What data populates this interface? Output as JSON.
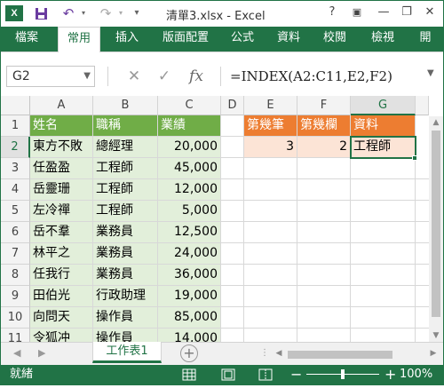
{
  "window": {
    "title": "清單3.xlsx - Excel",
    "help": "?",
    "minimize": "—",
    "restore": "❐",
    "close": "✕"
  },
  "quick_access": {
    "save": "💾",
    "undo": "↶",
    "redo": "↷",
    "customize": "⇩"
  },
  "ribbon": {
    "tabs": [
      "檔案",
      "常用",
      "插入",
      "版面配置",
      "公式",
      "資料",
      "校閱",
      "檢視",
      "開"
    ],
    "active_tab": "常用"
  },
  "formula_bar": {
    "name_box": "G2",
    "cancel_icon": "✕",
    "enter_icon": "✓",
    "fx_icon": "fx",
    "formula": "=INDEX(A2:C11,E2,F2)"
  },
  "columns": [
    "A",
    "B",
    "C",
    "D",
    "E",
    "F",
    "G"
  ],
  "rows": [
    "1",
    "2",
    "3",
    "4",
    "5",
    "6",
    "7",
    "8",
    "9",
    "10",
    "11"
  ],
  "table": {
    "headers": [
      "姓名",
      "職稱",
      "業績"
    ],
    "rows": [
      [
        "東方不敗",
        "總經理",
        "20,000"
      ],
      [
        "任盈盈",
        "工程師",
        "45,000"
      ],
      [
        "岳靈珊",
        "工程師",
        "12,000"
      ],
      [
        "左冷禪",
        "工程師",
        "5,000"
      ],
      [
        "岳不羣",
        "業務員",
        "12,500"
      ],
      [
        "林平之",
        "業務員",
        "24,000"
      ],
      [
        "任我行",
        "業務員",
        "36,000"
      ],
      [
        "田伯光",
        "行政助理",
        "19,000"
      ],
      [
        "向問天",
        "操作員",
        "85,000"
      ],
      [
        "令狐冲",
        "操作員",
        "14,000"
      ]
    ]
  },
  "lookup": {
    "headers": [
      "第幾筆",
      "第幾欄",
      "資料"
    ],
    "values": [
      "3",
      "2",
      "工程師"
    ]
  },
  "sheet_tabs": {
    "prev": "◀",
    "next": "▶",
    "active": "工作表1",
    "add": "+"
  },
  "status_bar": {
    "ready": "就緒",
    "zoom_out": "−",
    "zoom_in": "+",
    "zoom_percent": "100%"
  },
  "colors": {
    "excel_green": "#217346",
    "table_header": "#70ad47",
    "table_body": "#e2efda",
    "lookup_header": "#ed7d31",
    "lookup_body": "#fce4d6"
  }
}
